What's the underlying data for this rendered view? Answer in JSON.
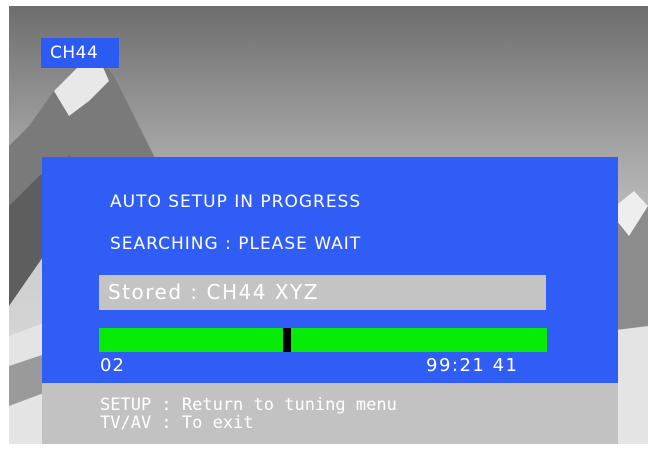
{
  "channel_badge": "CH44",
  "setup": {
    "title": "AUTO SETUP IN PROGRESS",
    "status": "SEARCHING : PLEASE WAIT",
    "stored": "Stored : CH44  XYZ",
    "progress_fraction": 0.42,
    "range_start": "02",
    "range_end": "99:21  41"
  },
  "help": {
    "line1": "SETUP : Return to tuning menu",
    "line2": "TV/AV : To exit"
  },
  "colors": {
    "osd_blue": "#2f5df5",
    "progress_green": "#06ec06",
    "panel_gray": "#c2c2c2"
  }
}
